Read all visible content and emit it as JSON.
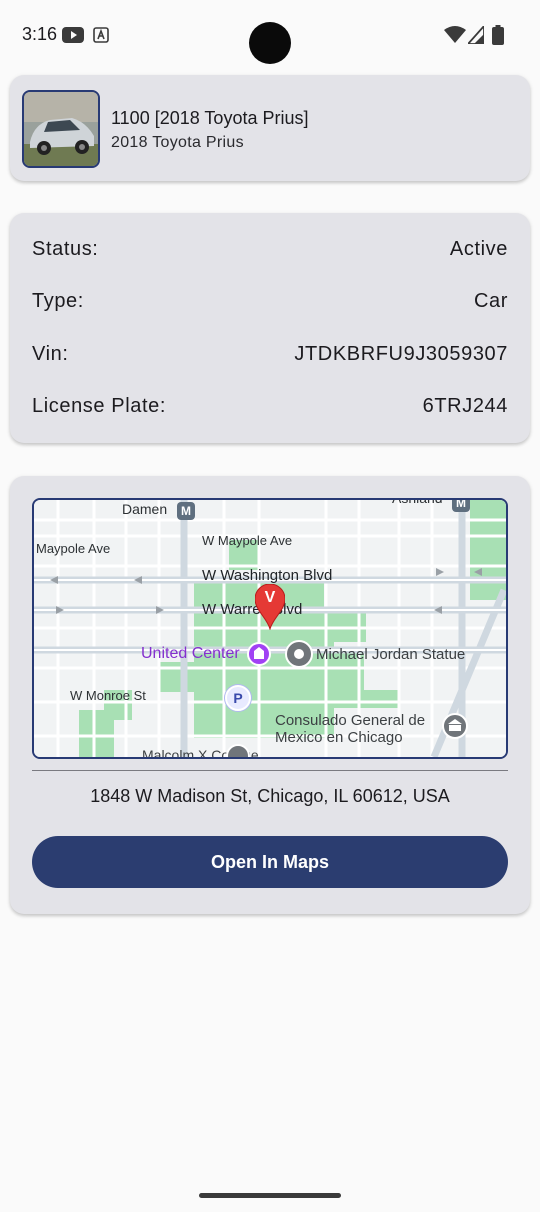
{
  "status_bar": {
    "time": "3:16",
    "icons_left": [
      "youtube-icon",
      "text-a-icon"
    ],
    "icons_right": [
      "wifi-icon",
      "signal-icon",
      "battery-icon"
    ]
  },
  "vehicle": {
    "title": "1100 [2018 Toyota Prius]",
    "subtitle": "2018 Toyota Prius",
    "thumbnail_icon": "car-photo"
  },
  "details": {
    "rows": [
      {
        "label": "Status:",
        "value": "Active"
      },
      {
        "label": "Type:",
        "value": "Car"
      },
      {
        "label": "Vin:",
        "value": "JTDKBRFU9J3059307"
      },
      {
        "label": "License Plate:",
        "value": "6TRJ244"
      }
    ]
  },
  "location": {
    "map": {
      "marker_label": "V",
      "labels": {
        "damen": "Damen",
        "ashland": "Ashland",
        "maypole_ave": "Maypole Ave",
        "w_maypole_ave": "W Maypole Ave",
        "w_washington": "W Washington Blvd",
        "w_warren": "W Warren Blvd",
        "united_center": "United Center",
        "jordan_statue": "Michael Jordan Statue",
        "w_monroe": "W Monroe St",
        "consulado_1": "Consulado General de",
        "consulado_2": "Mexico en Chicago",
        "malcolm_x": "Malcolm X College"
      },
      "transit_letter": "M",
      "parking_letter": "P"
    },
    "address": "1848 W Madison St, Chicago, IL 60612, USA",
    "open_button_label": "Open In Maps"
  },
  "colors": {
    "card_bg": "#e3e3e8",
    "accent": "#2b3d70",
    "marker": "#e53935",
    "park": "#a8e0b4"
  }
}
